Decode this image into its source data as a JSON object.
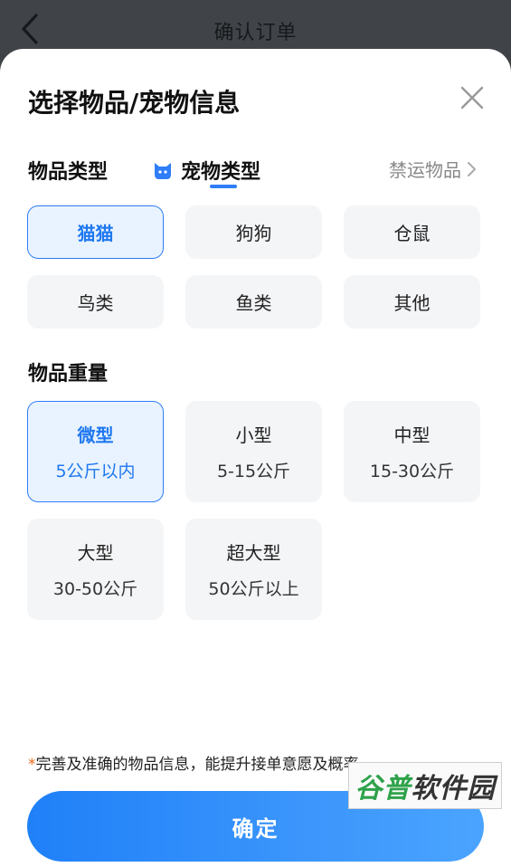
{
  "topbar": {
    "title": "确认订单"
  },
  "sheet": {
    "title": "选择物品/宠物信息",
    "tabs": {
      "item_type": "物品类型",
      "pet_type": "宠物类型"
    },
    "forbidden_link": "禁运物品",
    "pet_options": [
      {
        "label": "猫猫",
        "selected": true
      },
      {
        "label": "狗狗",
        "selected": false
      },
      {
        "label": "仓鼠",
        "selected": false
      },
      {
        "label": "鸟类",
        "selected": false
      },
      {
        "label": "鱼类",
        "selected": false
      },
      {
        "label": "其他",
        "selected": false
      }
    ],
    "weight_section_label": "物品重量",
    "weight_options": [
      {
        "label": "微型",
        "range": "5公斤以内",
        "selected": true
      },
      {
        "label": "小型",
        "range": "5-15公斤",
        "selected": false
      },
      {
        "label": "中型",
        "range": "15-30公斤",
        "selected": false
      },
      {
        "label": "大型",
        "range": "30-50公斤",
        "selected": false
      },
      {
        "label": "超大型",
        "range": "50公斤以上",
        "selected": false
      }
    ],
    "tip_star": "*",
    "tip": "完善及准确的物品信息，能提升接单意愿及概率",
    "confirm_label": "确定"
  },
  "watermark": {
    "part1": "谷普",
    "part2": "软件园"
  },
  "colors": {
    "accent": "#2f7df7",
    "chip_bg": "#f4f5f7",
    "selected_bg": "#e9f3ff",
    "star": "#f06b1e"
  }
}
